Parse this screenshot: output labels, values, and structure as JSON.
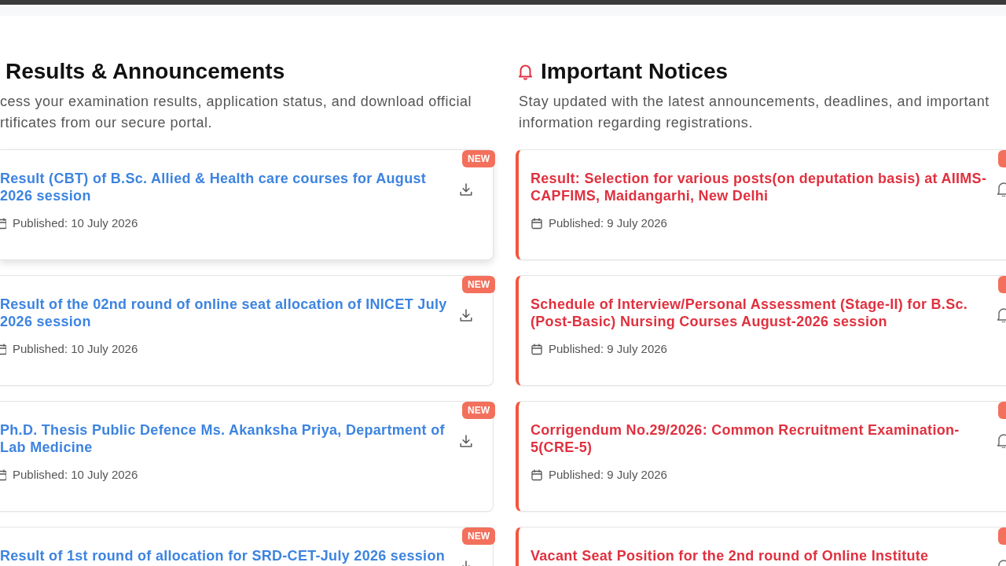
{
  "results_section": {
    "heading": "Results & Announcements",
    "description_lines": [
      "cess your examination results, application status, and download official",
      "rtificates from our secure portal."
    ],
    "items": [
      {
        "title_lines": [
          "Result (CBT) of B.Sc. Allied & Health care courses for August",
          "2026 session"
        ],
        "published": "Published: 10 July 2026",
        "badge": "NEW",
        "hovered": true
      },
      {
        "title_lines": [
          "Result of the 02nd round of online seat allocation of INICET July",
          "2026 session"
        ],
        "published": "Published: 10 July 2026",
        "badge": "NEW",
        "hovered": false
      },
      {
        "title_lines": [
          "Ph.D. Thesis Public Defence Ms. Akanksha Priya, Department of",
          "Lab Medicine"
        ],
        "published": "Published: 10 July 2026",
        "badge": "NEW",
        "hovered": false
      },
      {
        "title_lines": [
          "Result of 1st round of allocation for SRD-CET-July 2026 session"
        ],
        "badge": "NEW"
      }
    ]
  },
  "notices_section": {
    "heading": "Important Notices",
    "description": "Stay updated with the latest announcements, deadlines, and important information regarding registrations.",
    "items": [
      {
        "title": "Result: Selection for various posts(on deputation basis) at AIIMS-CAPFIMS, Maidangarhi, New Delhi",
        "published": "Published: 9 July 2026",
        "new": true
      },
      {
        "title": "Schedule of Interview/Personal Assessment (Stage-II) for B.Sc. (Post-Basic) Nursing Courses August-2026 session",
        "published": "Published: 9 July 2026",
        "new": true
      },
      {
        "title": "Corrigendum No.29/2026: Common Recruitment Examination-5(CRE-5)",
        "published": "Published: 9 July 2026",
        "new": true
      },
      {
        "title": "Vacant Seat Position for the 2nd round of Online Institute",
        "new": true
      }
    ]
  }
}
